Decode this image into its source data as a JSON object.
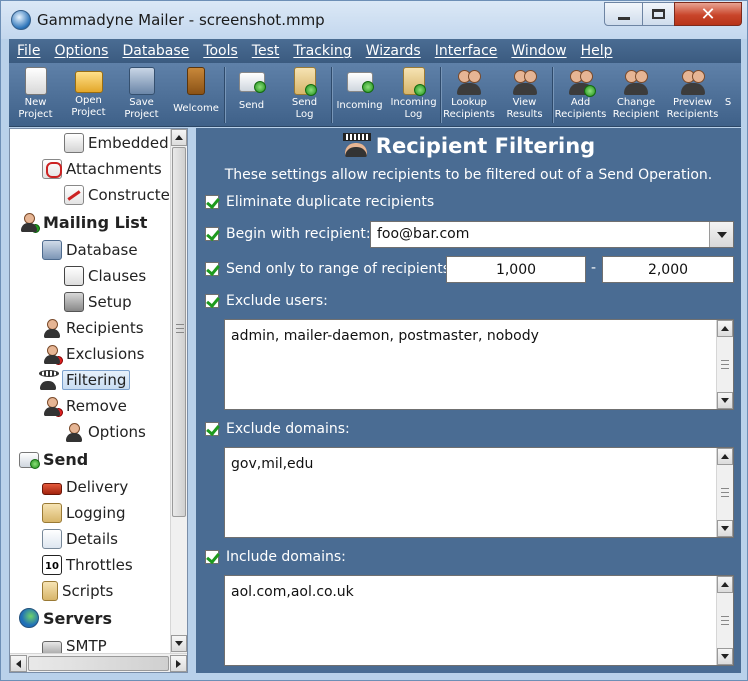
{
  "window": {
    "title": "Gammadyne Mailer - screenshot.mmp"
  },
  "menu": [
    "File",
    "Options",
    "Database",
    "Tools",
    "Test",
    "Tracking",
    "Wizards",
    "Interface",
    "Window",
    "Help"
  ],
  "toolbar": [
    {
      "label": "New\nProject",
      "icon": "new-project-icon"
    },
    {
      "label": "Open\nProject",
      "icon": "open-project-icon"
    },
    {
      "label": "Save\nProject",
      "icon": "save-project-icon"
    },
    {
      "label": "Welcome",
      "icon": "welcome-door-icon"
    },
    {
      "label": "Send",
      "icon": "send-mail-icon"
    },
    {
      "label": "Send\nLog",
      "icon": "send-log-icon"
    },
    {
      "label": "Incoming",
      "icon": "incoming-mail-icon"
    },
    {
      "label": "Incoming\nLog",
      "icon": "incoming-log-icon"
    },
    {
      "label": "Lookup\nRecipients",
      "icon": "lookup-recipients-icon"
    },
    {
      "label": "View\nResults",
      "icon": "view-results-icon"
    },
    {
      "label": "Add\nRecipients",
      "icon": "add-recipients-icon"
    },
    {
      "label": "Change\nRecipient",
      "icon": "change-recipient-icon"
    },
    {
      "label": "Preview\nRecipients",
      "icon": "preview-recipients-icon"
    },
    {
      "label": "S",
      "icon": "more-icon"
    }
  ],
  "tree": {
    "items": [
      {
        "label": "Embedded",
        "icon": "embedded-icon",
        "group": false
      },
      {
        "label": "Attachments",
        "icon": "attachments-icon",
        "group": false
      },
      {
        "label": "Constructe",
        "icon": "constructed-icon",
        "group": false
      },
      {
        "label": "Mailing List",
        "icon": "mailing-list-icon",
        "group": true
      },
      {
        "label": "Database",
        "icon": "database-icon",
        "group": false
      },
      {
        "label": "Clauses",
        "icon": "clauses-icon",
        "group": false
      },
      {
        "label": "Setup",
        "icon": "setup-icon",
        "group": false
      },
      {
        "label": "Recipients",
        "icon": "recipients-icon",
        "group": false
      },
      {
        "label": "Exclusions",
        "icon": "exclusions-icon",
        "group": false
      },
      {
        "label": "Filtering",
        "icon": "filtering-icon",
        "group": false,
        "selected": true
      },
      {
        "label": "Remove",
        "icon": "remove-icon",
        "group": false
      },
      {
        "label": "Options",
        "icon": "options-icon",
        "group": false
      },
      {
        "label": "Send",
        "icon": "send-icon",
        "group": true
      },
      {
        "label": "Delivery",
        "icon": "delivery-icon",
        "group": false
      },
      {
        "label": "Logging",
        "icon": "logging-icon",
        "group": false
      },
      {
        "label": "Details",
        "icon": "details-icon",
        "group": false
      },
      {
        "label": "Throttles",
        "icon": "throttles-icon",
        "group": false
      },
      {
        "label": "Scripts",
        "icon": "scripts-icon",
        "group": false
      },
      {
        "label": "Servers",
        "icon": "servers-icon",
        "group": true
      },
      {
        "label": "SMTP",
        "icon": "smtp-icon",
        "group": false
      }
    ]
  },
  "content": {
    "title": "Recipient Filtering",
    "subtitle": "These settings allow recipients to be filtered out of a Send Operation.",
    "eliminate_duplicates": {
      "label": "Eliminate duplicate recipients",
      "checked": true
    },
    "begin_with": {
      "label": "Begin with recipient:",
      "checked": true,
      "value": "foo@bar.com"
    },
    "range": {
      "label": "Send only to range of recipients:",
      "checked": true,
      "from": "1,000",
      "separator": "-",
      "to": "2,000"
    },
    "exclude_users": {
      "label": "Exclude users:",
      "checked": true,
      "value": "admin, mailer-daemon, postmaster, nobody"
    },
    "exclude_domains": {
      "label": "Exclude domains:",
      "checked": true,
      "value": "gov,mil,edu"
    },
    "include_domains": {
      "label": "Include domains:",
      "checked": true,
      "value": "aol.com,aol.co.uk"
    }
  },
  "colors": {
    "panel_bg": "#4a6c93",
    "toolbar_bg": "#5f81a9",
    "check_green": "#1e9a1e",
    "selected_bg": "#c8dcf2"
  }
}
